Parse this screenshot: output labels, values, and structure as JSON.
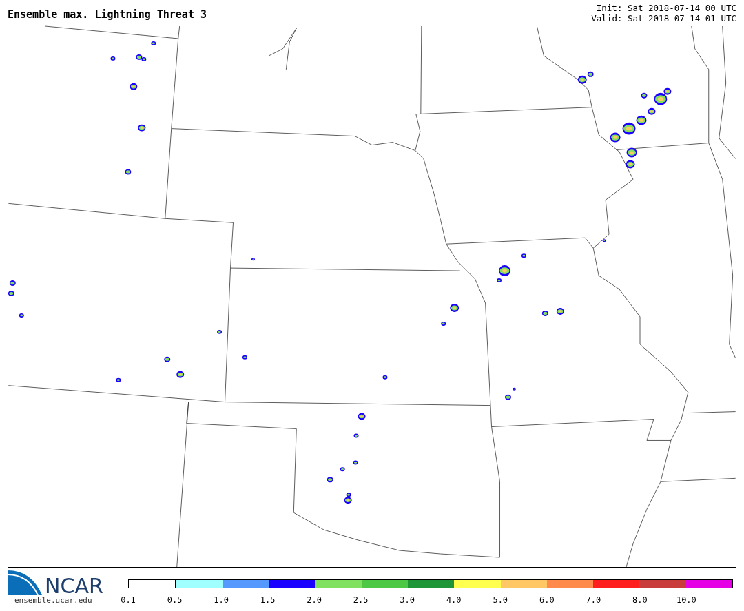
{
  "title": "Ensemble max. Lightning Threat 3",
  "init": "Init: Sat 2018-07-14 00 UTC",
  "valid": "Valid: Sat 2018-07-14 01 UTC",
  "logo": {
    "text": "NCAR",
    "site": "ensemble.ucar.edu"
  },
  "legend": [
    {
      "label": "0.1",
      "color": "#ffffff"
    },
    {
      "label": "0.5",
      "color": "#a0ffff"
    },
    {
      "label": "1.0",
      "color": "#5599ff"
    },
    {
      "label": "1.5",
      "color": "#1a00ff"
    },
    {
      "label": "2.0",
      "color": "#80e060"
    },
    {
      "label": "2.5",
      "color": "#4cc844"
    },
    {
      "label": "3.0",
      "color": "#1e9638"
    },
    {
      "label": "4.0",
      "color": "#ffff50"
    },
    {
      "label": "5.0",
      "color": "#ffc864"
    },
    {
      "label": "6.0",
      "color": "#ff8a4c"
    },
    {
      "label": "7.0",
      "color": "#ff1e1e"
    },
    {
      "label": "8.0",
      "color": "#c83c3c"
    },
    {
      "label": "10.0",
      "color": "#e600e6"
    }
  ]
}
